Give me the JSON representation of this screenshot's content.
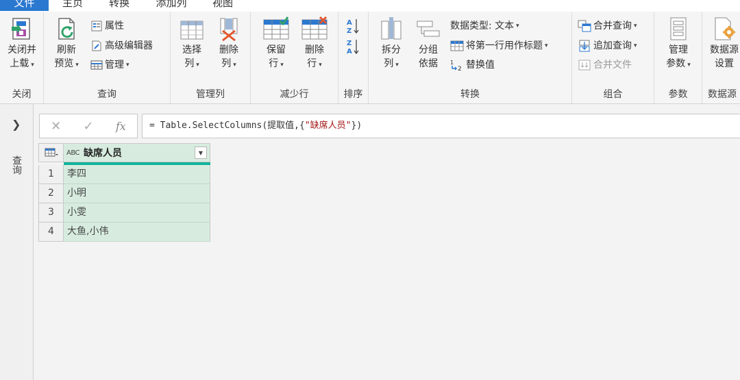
{
  "menu": {
    "tabs": [
      {
        "label": "文件"
      },
      {
        "label": "主页"
      },
      {
        "label": "转换"
      },
      {
        "label": "添加列"
      },
      {
        "label": "视图"
      }
    ]
  },
  "ribbon": {
    "close": {
      "label": "关闭",
      "close_load_line1": "关闭并",
      "close_load_line2": "上载"
    },
    "query": {
      "label": "查询",
      "refresh_line1": "刷新",
      "refresh_line2": "预览",
      "properties": "属性",
      "advanced_editor": "高级编辑器",
      "manage": "管理"
    },
    "manage_columns": {
      "label": "管理列",
      "choose_line1": "选择",
      "choose_line2": "列",
      "remove_line1": "删除",
      "remove_line2": "列"
    },
    "reduce_rows": {
      "label": "减少行",
      "keep_line1": "保留",
      "keep_line2": "行",
      "remove_line1": "删除",
      "remove_line2": "行"
    },
    "sort": {
      "label": "排序"
    },
    "transform": {
      "label": "转换",
      "split_line1": "拆分",
      "split_line2": "列",
      "group_line1": "分组",
      "group_line2": "依据",
      "data_type": "数据类型: 文本",
      "first_row_header": "将第一行用作标题",
      "replace_values": "替换值"
    },
    "combine": {
      "label": "组合",
      "merge_queries": "合并查询",
      "append_queries": "追加查询",
      "combine_files": "合并文件"
    },
    "parameters": {
      "label": "参数",
      "manage_line1": "管理",
      "manage_line2": "参数"
    },
    "data_source": {
      "label": "数据源",
      "settings_line1": "数据源",
      "settings_line2": "设置"
    }
  },
  "sidepane": {
    "label": "查询"
  },
  "formula_bar": {
    "fx": "fx",
    "prefix": "= Table.SelectColumns(提取值,{",
    "string": "\"缺席人员\"",
    "suffix": "})"
  },
  "table": {
    "column_header": "缺席人员",
    "type_icon": "ABC",
    "rows": [
      {
        "num": "1",
        "value": "李四"
      },
      {
        "num": "2",
        "value": "小明"
      },
      {
        "num": "3",
        "value": "小雯"
      },
      {
        "num": "4",
        "value": "大鱼,小伟"
      }
    ]
  },
  "colors": {
    "accent": "#2b78d0",
    "column_fill": "#d7ecdf",
    "quality_bar": "#12b39a"
  }
}
